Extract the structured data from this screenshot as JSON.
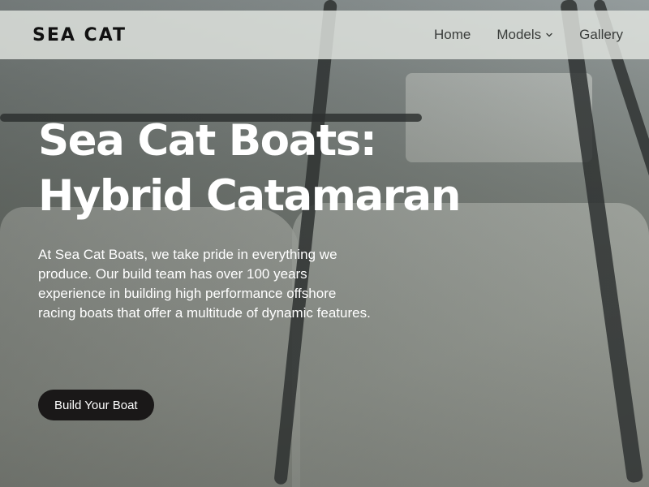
{
  "nav": {
    "logo": "SEA CAT",
    "links": [
      {
        "label": "Home"
      },
      {
        "label": "Models",
        "icon": "chevron-down-icon"
      },
      {
        "label": "Gallery"
      }
    ]
  },
  "hero": {
    "headline_line1": "Sea Cat Boats:",
    "headline_line2": "Hybrid Catamaran",
    "body": "At Sea Cat Boats, we take pride in everything we produce. Our build team has over 100 years experience in building high performance offshore racing boats that offer a multitude of dynamic features.",
    "cta_label": "Build Your Boat"
  },
  "colors": {
    "nav_bg": "#e2e5e0",
    "cta_bg": "#1a1818",
    "text_light": "#ffffff"
  }
}
